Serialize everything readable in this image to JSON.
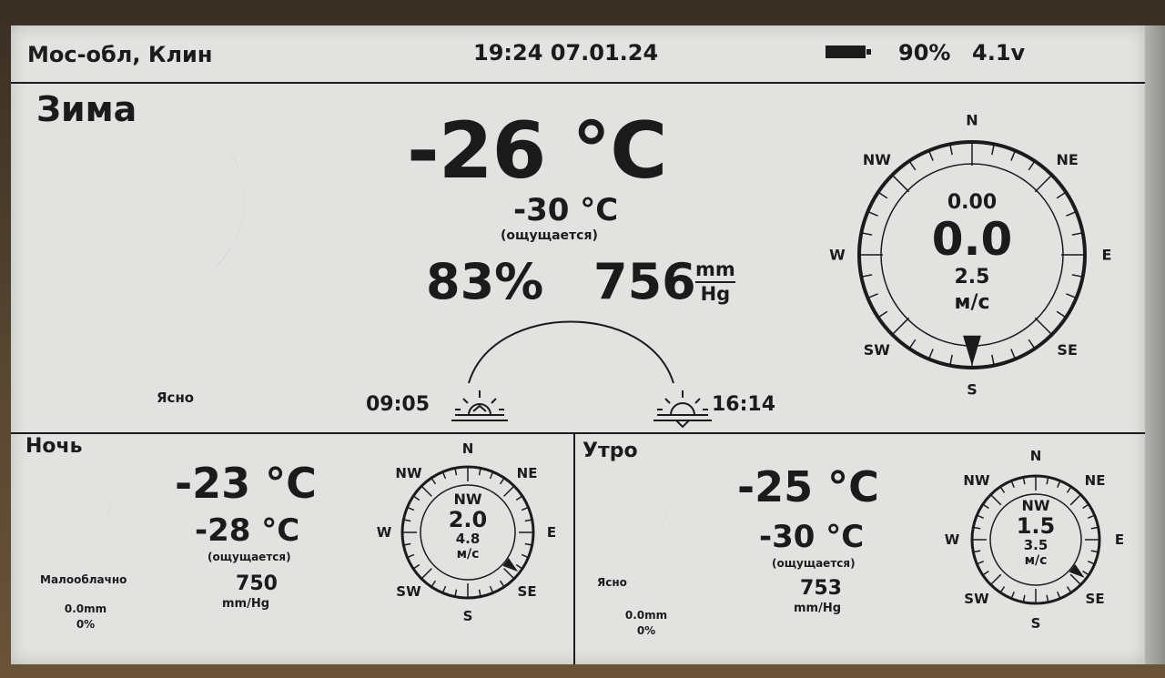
{
  "header": {
    "location": "Мос-обл, Клин",
    "datetime": "19:24 07.01.24",
    "battery_percent": "90%",
    "battery_voltage": "4.1v",
    "battery_icon": "battery-full-icon"
  },
  "current": {
    "season": "Зима",
    "condition": "Ясно",
    "icon": "moon-icon",
    "temperature": "-26 °C",
    "feels_like": "-30 °C",
    "feels_like_note": "(ощущается)",
    "humidity": "83%",
    "pressure": "756",
    "pressure_unit_top": "mm",
    "pressure_unit_bottom": "Hg",
    "sunrise": "09:05",
    "sunset": "16:14",
    "wind": {
      "directions": [
        "N",
        "NE",
        "E",
        "SE",
        "S",
        "SW",
        "W",
        "NW"
      ],
      "line1": "0.00",
      "speed": "0.0",
      "gust": "2.5",
      "unit": "м/с",
      "arrow_degrees": 180
    }
  },
  "night": {
    "title": "Ночь",
    "icon": "moon-icon",
    "condition": "Малооблачно",
    "precip": "0.0mm",
    "precip_chance": "0%",
    "temperature": "-23 °C",
    "feels_like": "-28 °C",
    "feels_like_note": "(ощущается)",
    "pressure": "750",
    "pressure_unit": "mm/Hg",
    "wind": {
      "directions": [
        "N",
        "NE",
        "E",
        "SE",
        "S",
        "SW",
        "W",
        "NW"
      ],
      "dir": "NW",
      "speed": "2.0",
      "gust": "4.8",
      "unit": "м/с",
      "arrow_degrees": 128
    }
  },
  "morning": {
    "title": "Утро",
    "icon": "moon-icon",
    "condition": "Ясно",
    "precip": "0.0mm",
    "precip_chance": "0%",
    "temperature": "-25 °C",
    "feels_like": "-30 °C",
    "feels_like_note": "(ощущается)",
    "pressure": "753",
    "pressure_unit": "mm/Hg",
    "wind": {
      "directions": [
        "N",
        "NE",
        "E",
        "SE",
        "S",
        "SW",
        "W",
        "NW"
      ],
      "dir": "NW",
      "speed": "1.5",
      "gust": "3.5",
      "unit": "м/с",
      "arrow_degrees": 128
    }
  }
}
